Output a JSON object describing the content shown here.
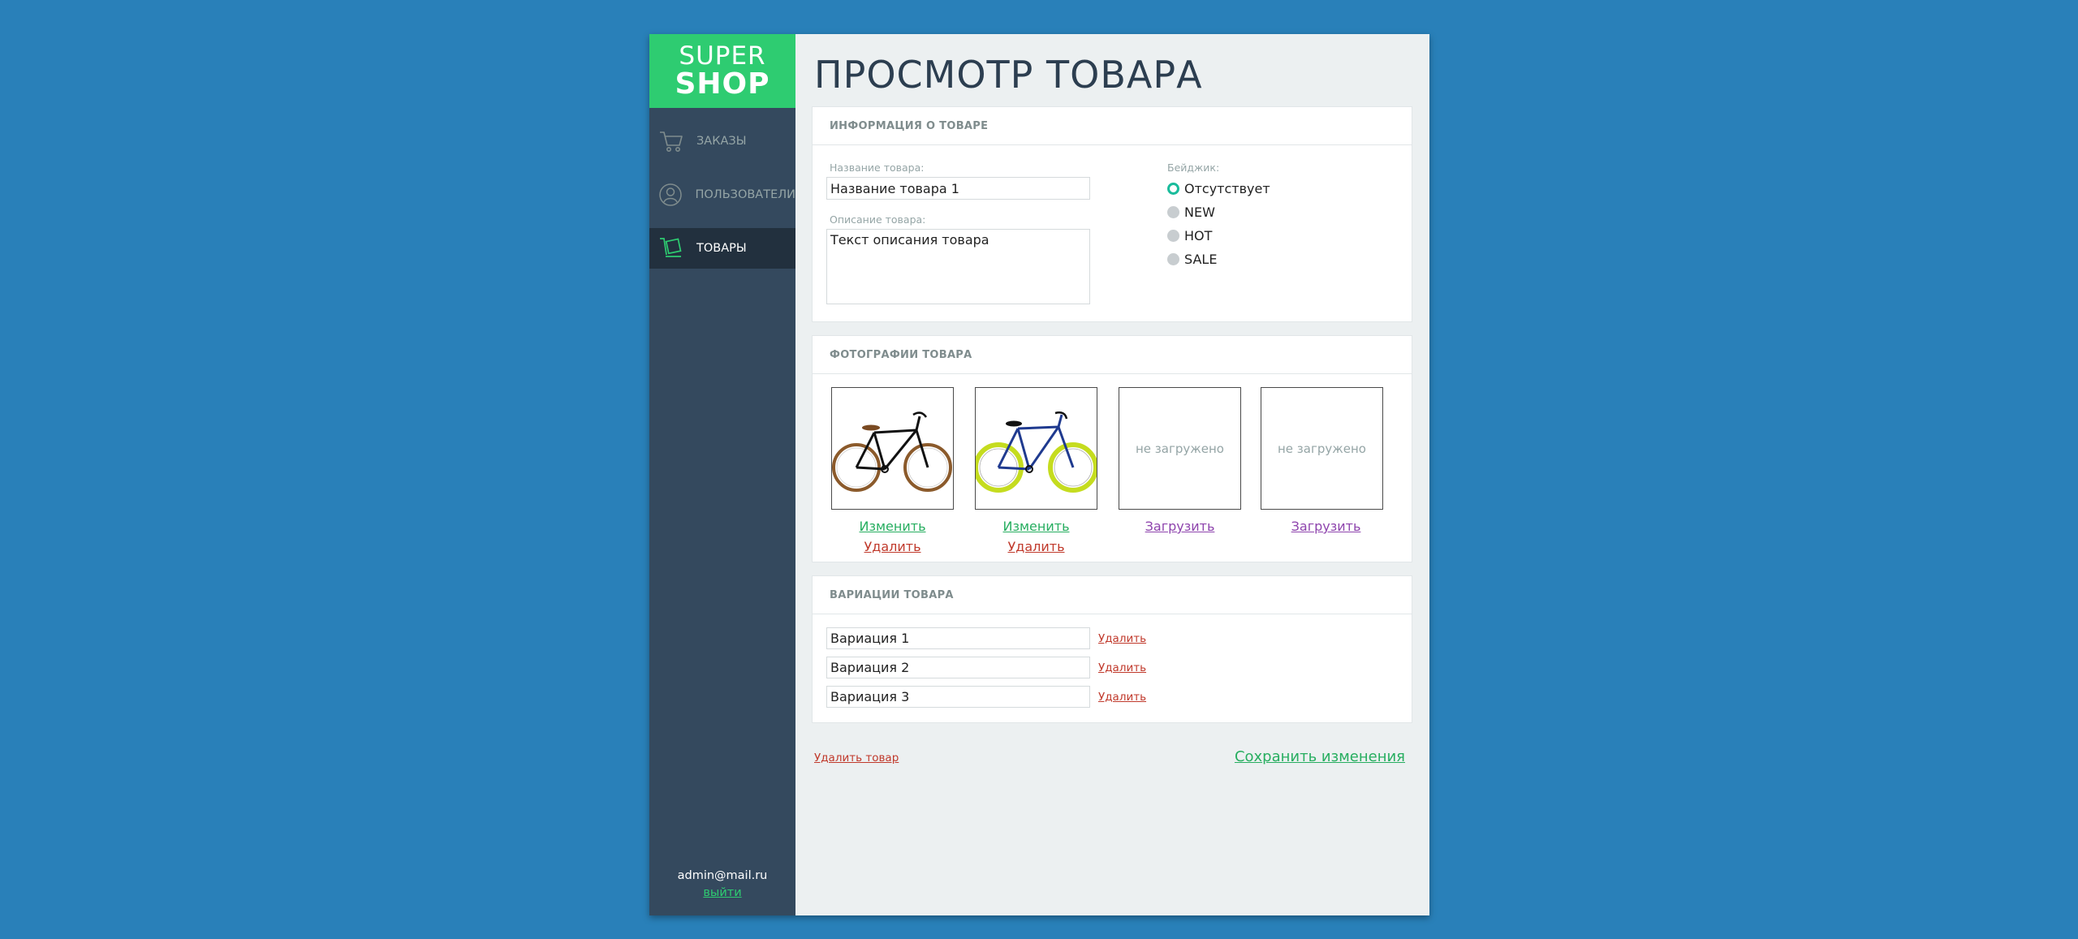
{
  "logo": {
    "line1": "SUPER",
    "line2": "SHOP"
  },
  "sidebar": {
    "items": [
      {
        "label": "ЗАКАЗЫ",
        "icon": "cart-icon",
        "active": false
      },
      {
        "label": "ПОЛЬЗОВАТЕЛИ",
        "icon": "user-icon",
        "active": false
      },
      {
        "label": "ТОВАРЫ",
        "icon": "product-tag-icon",
        "active": true
      }
    ],
    "user_email": "admin@mail.ru",
    "logout_label": "выйти"
  },
  "page": {
    "title": "ПРОСМОТР ТОВАРА"
  },
  "product_info": {
    "header": "ИНФОРМАЦИЯ О ТОВАРЕ",
    "name_label": "Название товара:",
    "name_value": "Название товара 1",
    "description_label": "Описание товара:",
    "description_value": "Текст описания товара",
    "badge_label": "Бейджик:",
    "badges": [
      {
        "label": "Отсутствует",
        "checked": true
      },
      {
        "label": "NEW",
        "checked": false
      },
      {
        "label": "HOT",
        "checked": false
      },
      {
        "label": "SALE",
        "checked": false
      }
    ]
  },
  "photos": {
    "header": "ФОТОГРАФИИ ТОВАРА",
    "items": [
      {
        "state": "loaded",
        "image": "black-bicycle",
        "change_label": "Изменить",
        "delete_label": "Удалить"
      },
      {
        "state": "loaded",
        "image": "blue-bicycle",
        "change_label": "Изменить",
        "delete_label": "Удалить"
      },
      {
        "state": "empty",
        "placeholder": "не загружено",
        "upload_label": "Загрузить"
      },
      {
        "state": "empty",
        "placeholder": "не загружено",
        "upload_label": "Загрузить"
      }
    ]
  },
  "variations": {
    "header": "ВАРИАЦИИ ТОВАРА",
    "items": [
      {
        "value": "Вариация 1",
        "delete_label": "Удалить"
      },
      {
        "value": "Вариация 2",
        "delete_label": "Удалить"
      },
      {
        "value": "Вариация 3",
        "delete_label": "Удалить"
      }
    ]
  },
  "footer": {
    "delete_product_label": "Удалить товар",
    "save_label": "Сохранить изменения"
  },
  "colors": {
    "background": "#2980b9",
    "sidebar": "#34495e",
    "logo": "#2ecc71",
    "accent_green": "#27ae60",
    "accent_red": "#c0392b",
    "accent_purple": "#8e44ad",
    "radio_checked": "#1abc9c"
  }
}
